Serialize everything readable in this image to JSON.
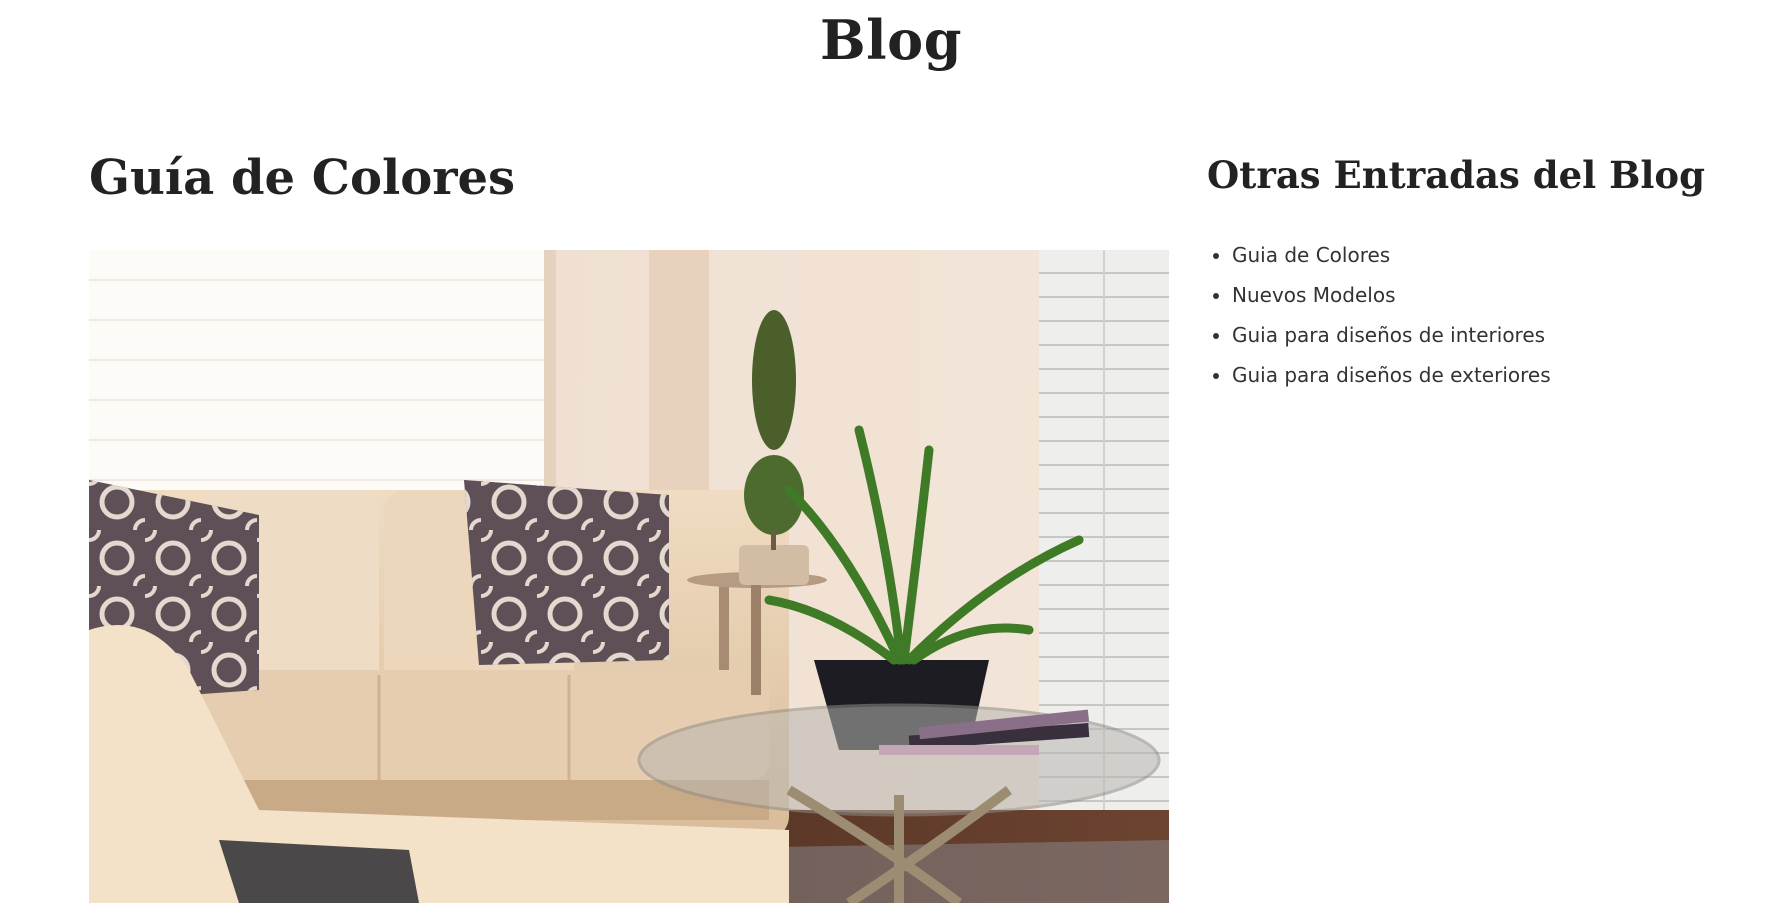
{
  "page": {
    "title": "Blog"
  },
  "post": {
    "title": "Guía de Colores",
    "image_subject": "living-room-photo"
  },
  "sidebar": {
    "title": "Otras Entradas del Blog",
    "items": [
      {
        "label": "Guia de Colores"
      },
      {
        "label": "Nuevos Modelos"
      },
      {
        "label": "Guia para diseños de interiores"
      },
      {
        "label": "Guia para diseños de exteriores"
      }
    ]
  },
  "colors": {
    "text": "#222222",
    "link": "#333333",
    "background": "#ffffff"
  }
}
